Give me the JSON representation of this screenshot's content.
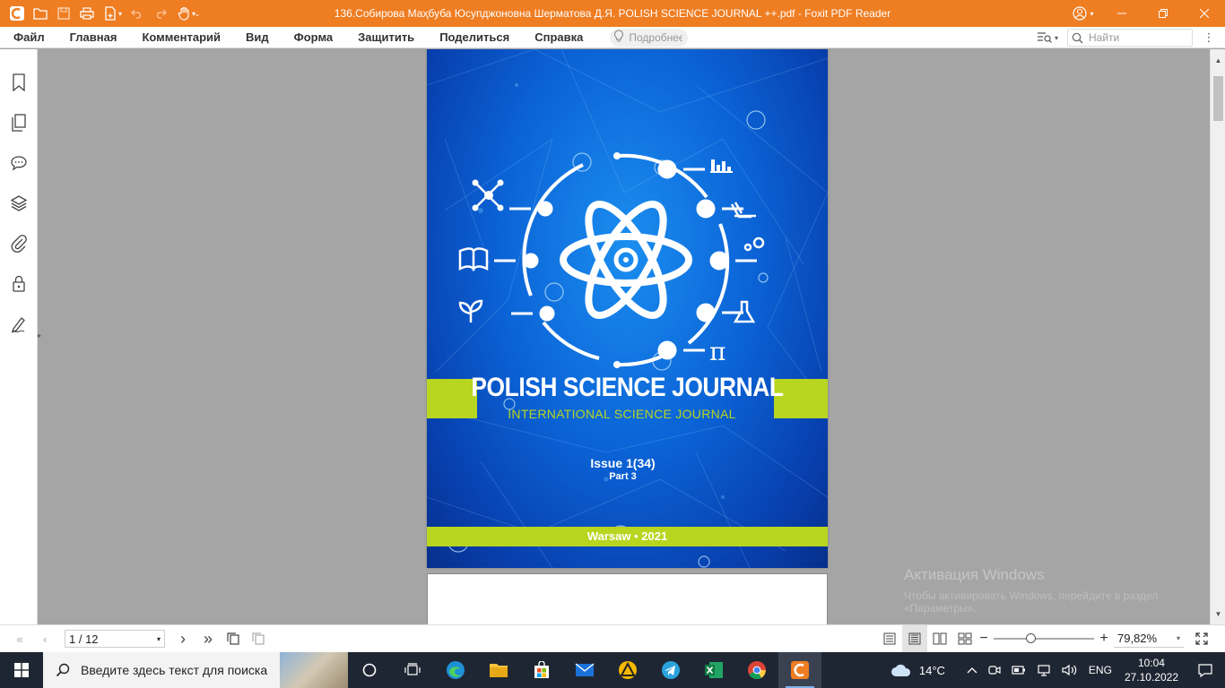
{
  "window": {
    "title": "136.Собирова Маҳбуба Юсупджоновна Шерматова Д.Я. POLISH SCIENCE JOURNAL ++.pdf - Foxit PDF Reader"
  },
  "menu": {
    "items": [
      "Файл",
      "Главная",
      "Комментарий",
      "Вид",
      "Форма",
      "Защитить",
      "Поделиться",
      "Справка"
    ],
    "tellme_placeholder": "Подробнее",
    "search_placeholder": "Найти"
  },
  "cover": {
    "title": "POLISH SCIENCE JOURNAL",
    "subtitle": "INTERNATIONAL SCIENCE JOURNAL",
    "issue": "Issue 1(34)",
    "part": "Part 3",
    "footer": "Warsaw • 2021"
  },
  "nav": {
    "page_indicator": "1 / 12",
    "zoom": "79,82%",
    "zoom_level": 0.36
  },
  "watermark": {
    "line1": "Активация Windows",
    "line2": "Чтобы активировать Windows, перейдите в раздел «Параметры»."
  },
  "taskbar": {
    "search_placeholder": "Введите здесь текст для поиска",
    "weather": "14°C",
    "language": "ENG",
    "time": "10:04",
    "date": "27.10.2022"
  },
  "colors": {
    "titlebar": "#ef7d22",
    "accent_green": "#b8d520",
    "cover_blue": "#0b63d6",
    "taskbar": "#1f2633"
  }
}
